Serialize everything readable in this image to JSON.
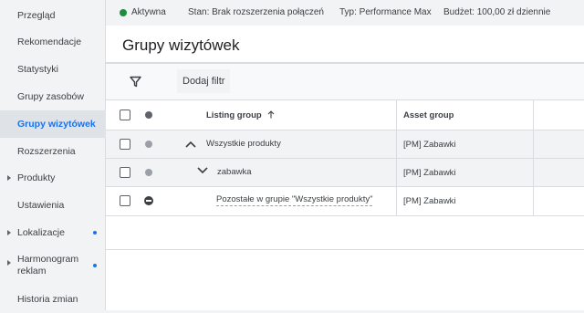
{
  "sidebar": {
    "items": [
      {
        "label": "Przegląd"
      },
      {
        "label": "Rekomendacje"
      },
      {
        "label": "Statystyki"
      },
      {
        "label": "Grupy zasobów"
      },
      {
        "label": "Grupy wizytówek",
        "active": true
      },
      {
        "label": "Rozszerzenia"
      },
      {
        "label": "Produkty",
        "expandable": true
      },
      {
        "label": "Ustawienia"
      },
      {
        "label": "Lokalizacje",
        "expandable": true,
        "dot": true
      },
      {
        "label": "Harmonogram",
        "label2": "reklam",
        "expandable": true,
        "dot": true
      },
      {
        "label": "Historia zmian"
      }
    ]
  },
  "topbar": {
    "status": "Aktywna",
    "state": "Stan: Brak rozszerzenia połączeń",
    "type": "Typ: Performance Max",
    "budget": "Budżet: 100,00 zł dziennie"
  },
  "page": {
    "title": "Grupy wizytówek"
  },
  "toolbar": {
    "add_filter": "Dodaj filtr"
  },
  "table": {
    "headers": {
      "listing_group": "Listing group",
      "asset_group": "Asset group"
    },
    "rows": [
      {
        "listing_group": "Wszystkie produkty",
        "asset_group": "[PM] Zabawki",
        "expand": "up"
      },
      {
        "listing_group": "zabawka",
        "asset_group": "[PM] Zabawki",
        "expand": "down"
      },
      {
        "listing_group": "Pozostałe w grupie \"Wszystkie produkty\"",
        "asset_group": "[PM] Zabawki",
        "expand": "none"
      }
    ]
  },
  "colors": {
    "accent": "#1a73e8",
    "status_active": "#1e8e3e"
  }
}
